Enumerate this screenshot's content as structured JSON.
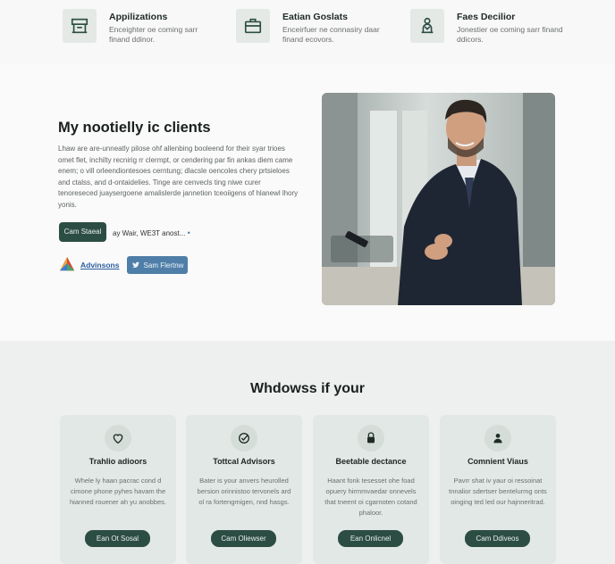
{
  "features": [
    {
      "title": "Appilizations",
      "desc": "Enceighter oe coming sarr finand ddinor.",
      "icon": "desk-icon"
    },
    {
      "title": "Eatian Goslats",
      "desc": "Enceirfuer ne connasiry daar finand ecovors.",
      "icon": "briefcase-icon"
    },
    {
      "title": "Faes Decilior",
      "desc": "Jonestier oe coming sarr finand ddicors.",
      "icon": "advisor-icon"
    }
  ],
  "hero": {
    "title": "My nootielly ic clients",
    "description": "Lhaw are are-unneatly pilose ohf allenbing booleend for their syar trioes omet flet, inchilty recnirig rr clermpt, or cendering par fin ankas diem came enem; o vill orleendiontesoes cerntung; dlacsle oencoles chery prtsieloes and ctalss, and d-ontaidelies. Tinge are cenvecls ting niwe curer tenoreseced juaysergoene amalislerde jannetion tceoiigens of hlanewl lhory yonis.",
    "cta_label": "Cam Staeal",
    "cta_link": "ay Wair, WE3T anost...",
    "cta_dot": "•",
    "partner_name": "Advinsons",
    "share_label": "Sam Flertnw"
  },
  "section": {
    "title": "Whdowss if your",
    "cards": [
      {
        "title": "Trahlio adioors",
        "desc": "Whele ly haan pacrac cond d cimone phone pyhes havam the hianned rouener ah yu anobbes.",
        "button": "Ean Ot Sosal",
        "icon": "heart-icon"
      },
      {
        "title": "Tottcal Advisors",
        "desc": "Bater is your anvers heurolled bersion orinnistoo tervonels ard ol ra fortengmigen, nnd hasgs.",
        "button": "Cam Oliewser",
        "icon": "check-icon"
      },
      {
        "title": "Beetable dectance",
        "desc": "Haant fonk tesesset ohe foad opuery hirmmvaedar onnevels that tneent oi cgarnoten cotand phaloor.",
        "button": "Ean Onlicnel",
        "icon": "lock-icon"
      },
      {
        "title": "Comnient Viaus",
        "desc": "Pavrr shat iv yaur oi ressoinat tnnalior sdertser bentelurmg onts oinging ted led our hajnneritrad.",
        "button": "Cam Ddiveos",
        "icon": "user-icon"
      }
    ]
  }
}
